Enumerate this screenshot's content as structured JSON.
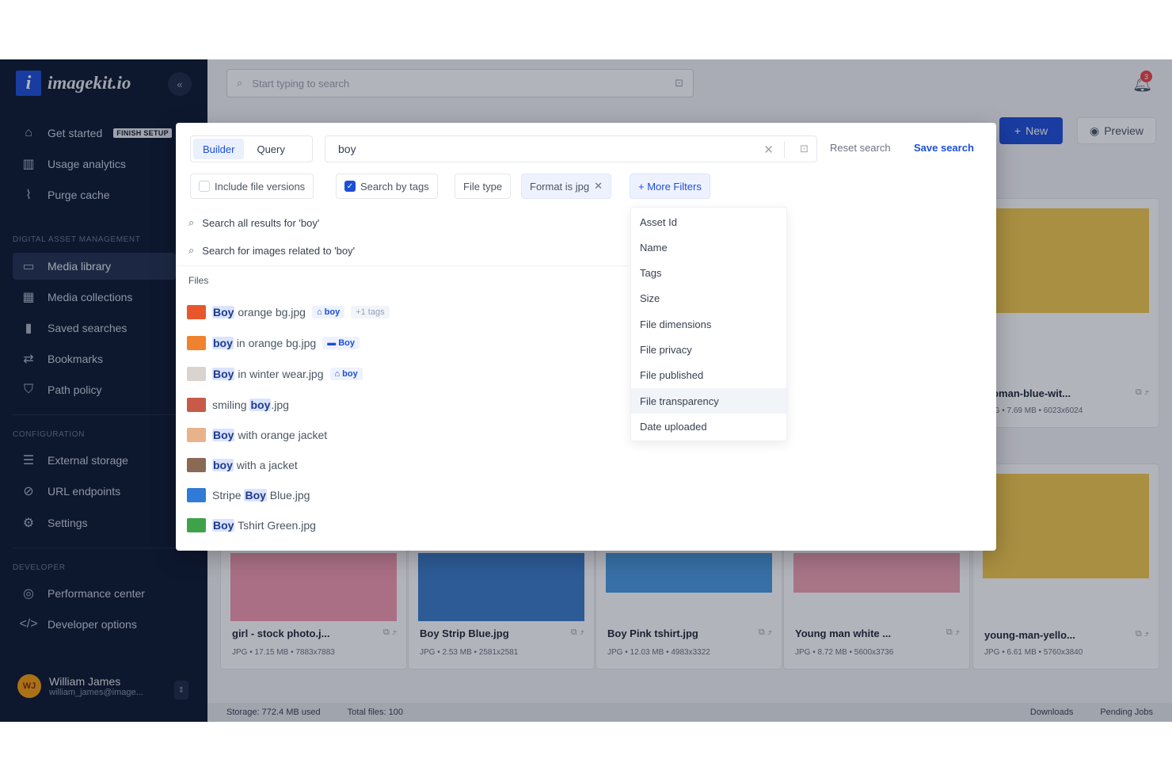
{
  "app": {
    "logo_letter": "i",
    "logo_text": "imagekit.io",
    "collapse_icon": "«"
  },
  "sidebar": {
    "top_items": [
      {
        "label": "Get started",
        "badge": "FINISH SETUP",
        "icon": "home-icon"
      },
      {
        "label": "Usage analytics",
        "icon": "chart-icon"
      },
      {
        "label": "Purge cache",
        "icon": "broom-icon"
      }
    ],
    "dam_label": "DIGITAL ASSET MANAGEMENT",
    "dam_items": [
      {
        "label": "Media library",
        "icon": "folder-icon",
        "active": true
      },
      {
        "label": "Media collections",
        "icon": "grid-icon"
      },
      {
        "label": "Saved searches",
        "icon": "bookmark-icon"
      },
      {
        "label": "Bookmarks",
        "icon": "link-icon"
      },
      {
        "label": "Path policy",
        "icon": "shield-icon"
      }
    ],
    "config_label": "CONFIGURATION",
    "config_items": [
      {
        "label": "External storage",
        "icon": "database-icon"
      },
      {
        "label": "URL endpoints",
        "icon": "chain-icon"
      },
      {
        "label": "Settings",
        "icon": "gear-icon"
      }
    ],
    "dev_label": "DEVELOPER",
    "dev_items": [
      {
        "label": "Performance center",
        "icon": "gauge-icon"
      },
      {
        "label": "Developer options",
        "icon": "code-icon"
      }
    ],
    "user": {
      "initials": "WJ",
      "name": "William James",
      "email": "william_james@image..."
    }
  },
  "header": {
    "search_placeholder": "Start typing to search",
    "notification_count": "3",
    "new_label": "New",
    "preview_label": "Preview"
  },
  "cards": [
    {
      "name": "woman-blue-wit...",
      "meta": "JPG • 7.69 MB • 6023x6024"
    },
    {
      "name": "young-man-yello...",
      "meta": "JPG • 6.61 MB • 5760x3840"
    },
    {
      "name": "girl - stock photo.j...",
      "meta": "JPG • 17.15 MB • 7883x7883"
    },
    {
      "name": "Boy Strip Blue.jpg",
      "meta": "JPG • 2.53 MB • 2581x2581"
    },
    {
      "name": "Boy Pink tshirt.jpg",
      "meta": "JPG • 12.03 MB • 4983x3322"
    },
    {
      "name": "Young man white ...",
      "meta": "JPG • 8.72 MB • 5600x3736"
    }
  ],
  "status": {
    "storage": "Storage: 772.4 MB used",
    "total": "Total files: 100",
    "downloads": "Downloads",
    "pending": "Pending Jobs"
  },
  "modal": {
    "modes": [
      "Builder",
      "Query"
    ],
    "query_value": "boy",
    "reset_label": "Reset search",
    "save_label": "Save search",
    "filters": {
      "include_versions": "Include file versions",
      "search_by_tags": "Search by tags",
      "file_type": "File type",
      "format": "Format is jpg",
      "more": "+ More Filters"
    },
    "suggest_all": "Search all results for 'boy'",
    "suggest_related": "Search for images related to 'boy'",
    "files_heading": "Files",
    "files": [
      {
        "pre": "",
        "hl": "Boy",
        "post": " orange bg.jpg",
        "tag": "boy",
        "more": "+1 tags",
        "color": "#e8572b"
      },
      {
        "pre": "",
        "hl": "boy",
        "post": " in orange bg.jpg",
        "tag": "Boy",
        "color": "#f0822f"
      },
      {
        "pre": "",
        "hl": "Boy",
        "post": " in winter wear.jpg",
        "tag": "boy",
        "color": "#d9d4cf"
      },
      {
        "pre": "smiling ",
        "hl": "boy",
        "post": ".jpg",
        "color": "#c85a4a"
      },
      {
        "pre": "",
        "hl": "Boy",
        "post": " with orange jacket",
        "color": "#e8b28a"
      },
      {
        "pre": "",
        "hl": "boy",
        "post": " with a jacket",
        "color": "#8a6a55"
      },
      {
        "pre": "Stripe ",
        "hl": "Boy",
        "post": " Blue.jpg",
        "color": "#2f7bd6"
      },
      {
        "pre": "",
        "hl": "Boy",
        "post": " Tshirt Green.jpg",
        "color": "#3fa24a"
      }
    ],
    "more_filters": [
      "Asset Id",
      "Name",
      "Tags",
      "Size",
      "File dimensions",
      "File privacy",
      "File published",
      "File transparency",
      "Date uploaded"
    ]
  }
}
